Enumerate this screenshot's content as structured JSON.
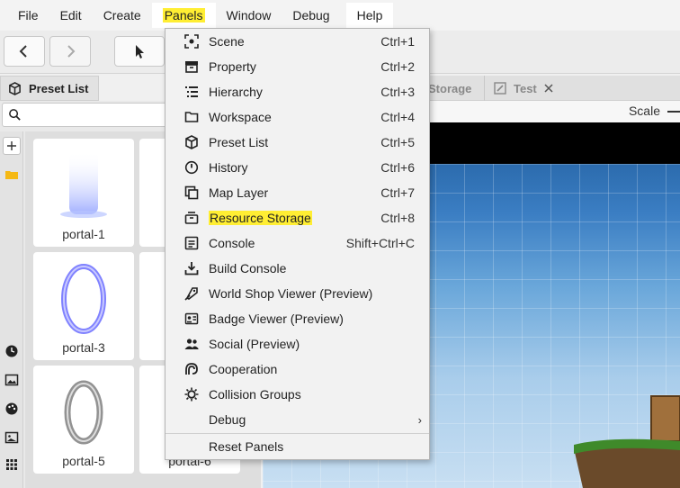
{
  "menubar": {
    "items": [
      "File",
      "Edit",
      "Create",
      "Panels",
      "Window",
      "Debug",
      "Help"
    ]
  },
  "left_panel": {
    "tab_label": "Preset List",
    "cards": [
      {
        "label": "portal-1"
      },
      {
        "label": "portal-3"
      },
      {
        "label": "portal-5"
      },
      {
        "label": "portal-6"
      }
    ]
  },
  "doc_tabs": [
    {
      "label": "Storage"
    },
    {
      "label": "Test"
    }
  ],
  "scale": {
    "label": "Scale"
  },
  "panels_menu": {
    "items": [
      {
        "label": "Scene",
        "shortcut": "Ctrl+1",
        "icon": "scene-icon"
      },
      {
        "label": "Property",
        "shortcut": "Ctrl+2",
        "icon": "property-icon"
      },
      {
        "label": "Hierarchy",
        "shortcut": "Ctrl+3",
        "icon": "hierarchy-icon"
      },
      {
        "label": "Workspace",
        "shortcut": "Ctrl+4",
        "icon": "folder-icon"
      },
      {
        "label": "Preset List",
        "shortcut": "Ctrl+5",
        "icon": "cube-icon"
      },
      {
        "label": "History",
        "shortcut": "Ctrl+6",
        "icon": "history-icon"
      },
      {
        "label": "Map Layer",
        "shortcut": "Ctrl+7",
        "icon": "layers-icon"
      },
      {
        "label": "Resource Storage",
        "shortcut": "Ctrl+8",
        "icon": "storage-icon",
        "highlighted": true
      },
      {
        "label": "Console",
        "shortcut": "Shift+Ctrl+C",
        "icon": "console-icon"
      },
      {
        "label": "Build Console",
        "shortcut": "",
        "icon": "download-icon"
      },
      {
        "label": "World Shop Viewer (Preview)",
        "shortcut": "",
        "icon": "shop-icon"
      },
      {
        "label": "Badge Viewer (Preview)",
        "shortcut": "",
        "icon": "badge-icon"
      },
      {
        "label": "Social (Preview)",
        "shortcut": "",
        "icon": "social-icon"
      },
      {
        "label": "Cooperation",
        "shortcut": "",
        "icon": "cooperation-icon"
      },
      {
        "label": "Collision Groups",
        "shortcut": "",
        "icon": "collision-icon"
      },
      {
        "label": "Debug",
        "shortcut": "",
        "icon": "",
        "submenu": true
      }
    ],
    "reset_label": "Reset Panels"
  }
}
